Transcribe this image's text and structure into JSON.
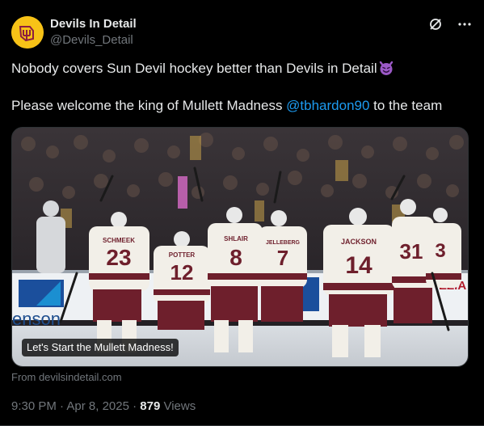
{
  "author": {
    "display_name": "Devils In Detail",
    "handle": "@Devils_Detail"
  },
  "header_icons": [
    "grok-icon",
    "more-icon"
  ],
  "tweet": {
    "line1": "Nobody covers Sun Devil hockey better than Devils in Detail",
    "line2_pre": "Please welcome the king of Mullett Madness ",
    "mention": "@tbhardon90",
    "line2_post": " to the team"
  },
  "media": {
    "caption": "Let's Start the Mullett Madness!",
    "jersey_names": [
      "SCHMEEK",
      "POTTER",
      "SHLAIR",
      "JELLEBERG",
      "JACKSON"
    ],
    "jersey_numbers": [
      "23",
      "12",
      "8",
      "7",
      "14",
      "31",
      "3"
    ],
    "board_text_left": "enson",
    "board_text_right": "EZIA"
  },
  "source": "From devilsindetail.com",
  "meta": {
    "time": "9:30 PM",
    "sep1": " · ",
    "date": "Apr 8, 2025",
    "sep2": " · ",
    "views": "879",
    "views_label": " Views"
  },
  "colors": {
    "background": "#000000",
    "text": "#e7e9ea",
    "muted": "#71767b",
    "link": "#1d9bf0",
    "avatar": "#f7c217",
    "jersey_maroon": "#6e1f2c"
  }
}
